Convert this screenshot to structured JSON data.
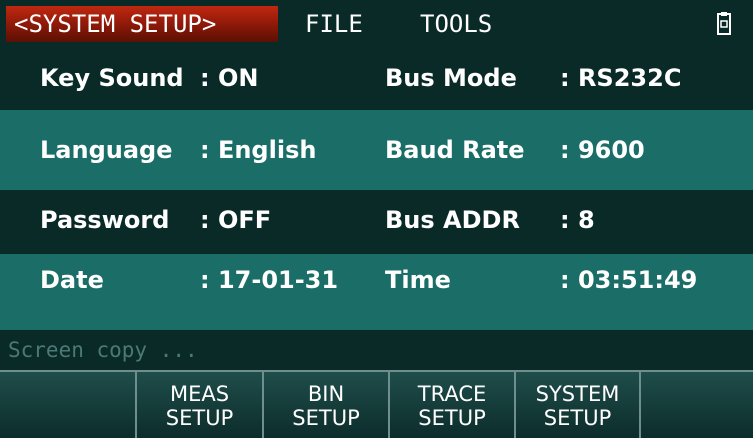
{
  "menubar": {
    "title": "<SYSTEM SETUP>",
    "file": "FILE",
    "tools": "TOOLS",
    "usb_icon": "usb-icon"
  },
  "settings": {
    "key_sound": {
      "label": "Key Sound",
      "value": ": ON"
    },
    "bus_mode": {
      "label": "Bus Mode",
      "value": ": RS232C"
    },
    "language": {
      "label": "Language",
      "value": ": English"
    },
    "baud_rate": {
      "label": "Baud Rate",
      "value": ": 9600"
    },
    "password": {
      "label": "Password",
      "value": ": OFF"
    },
    "bus_addr": {
      "label": "Bus ADDR",
      "value": ": 8"
    },
    "date": {
      "label": "Date",
      "value": ": 17-01-31"
    },
    "time": {
      "label": "Time",
      "value": ": 03:51:49"
    }
  },
  "status": {
    "text": "Screen copy ..."
  },
  "softkeys": [
    {
      "line1": "",
      "line2": ""
    },
    {
      "line1": "MEAS",
      "line2": "SETUP"
    },
    {
      "line1": "BIN",
      "line2": "SETUP"
    },
    {
      "line1": "TRACE",
      "line2": "SETUP"
    },
    {
      "line1": "SYSTEM",
      "line2": "SETUP"
    },
    {
      "line1": "",
      "line2": ""
    }
  ],
  "colors": {
    "background": "#0a2a28",
    "highlight_row": "#1b6e68",
    "title_red": "#c02810",
    "status_text": "#4b7a74"
  }
}
